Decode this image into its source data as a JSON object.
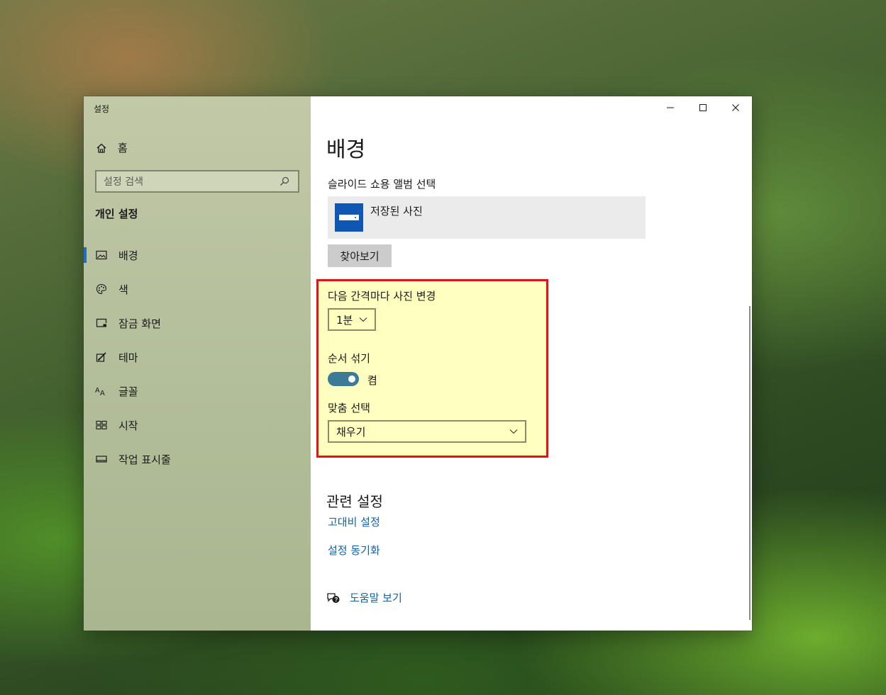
{
  "window": {
    "app_title": "설정",
    "controls": {
      "minimize": "—",
      "maximize": "☐",
      "close": "✕"
    }
  },
  "sidebar": {
    "home_label": "홈",
    "search_placeholder": "설정 검색",
    "section_title": "개인 설정",
    "items": [
      {
        "label": "배경",
        "icon": "picture-icon",
        "active": true
      },
      {
        "label": "색",
        "icon": "palette-icon"
      },
      {
        "label": "잠금 화면",
        "icon": "lock-screen-icon"
      },
      {
        "label": "테마",
        "icon": "theme-brush-icon"
      },
      {
        "label": "글꼴",
        "icon": "font-icon"
      },
      {
        "label": "시작",
        "icon": "start-grid-icon"
      },
      {
        "label": "작업 표시줄",
        "icon": "taskbar-icon"
      }
    ]
  },
  "main": {
    "page_title": "배경",
    "album_label": "슬라이드 쇼용 앨범 선택",
    "album_name": "저장된 사진",
    "browse_label": "찾아보기",
    "interval_label": "다음 간격마다 사진 변경",
    "interval_value": "1분",
    "shuffle_label": "순서 섞기",
    "shuffle_state": "켬",
    "fit_label": "맞춤 선택",
    "fit_value": "채우기",
    "related_title": "관련 설정",
    "link_high_contrast": "고대비 설정",
    "link_sync": "설정 동기화",
    "help_label": "도움말 보기"
  },
  "colors": {
    "accent": "#1f6fbf",
    "link": "#1261a8",
    "toggle_on": "#3c7a95",
    "highlight_fill": "#ffffc0",
    "highlight_border": "#e01414"
  }
}
